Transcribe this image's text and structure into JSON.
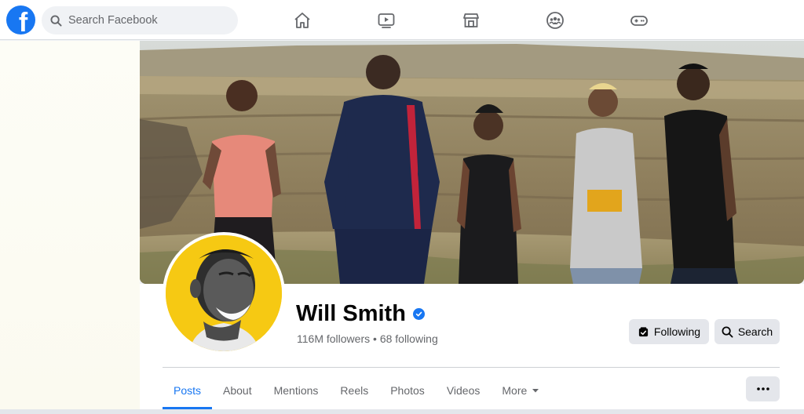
{
  "topbar": {
    "logo_letter": "f",
    "search_placeholder": "Search Facebook",
    "nav_icons": [
      "home-icon",
      "watch-icon",
      "marketplace-icon",
      "groups-icon",
      "gaming-icon"
    ]
  },
  "profile": {
    "name": "Will Smith",
    "verified": true,
    "followers": "116M followers",
    "separator": "•",
    "following": "68 following"
  },
  "actions": {
    "following_label": "Following",
    "search_label": "Search"
  },
  "tabs": [
    {
      "label": "Posts",
      "active": true
    },
    {
      "label": "About",
      "active": false
    },
    {
      "label": "Mentions",
      "active": false
    },
    {
      "label": "Reels",
      "active": false
    },
    {
      "label": "Photos",
      "active": false
    },
    {
      "label": "Videos",
      "active": false
    },
    {
      "label": "More",
      "active": false
    }
  ],
  "colors": {
    "brand": "#1877f2",
    "avatar_bg": "#f6c913",
    "button_bg": "#e4e6eb",
    "secondary_text": "#65676b"
  }
}
